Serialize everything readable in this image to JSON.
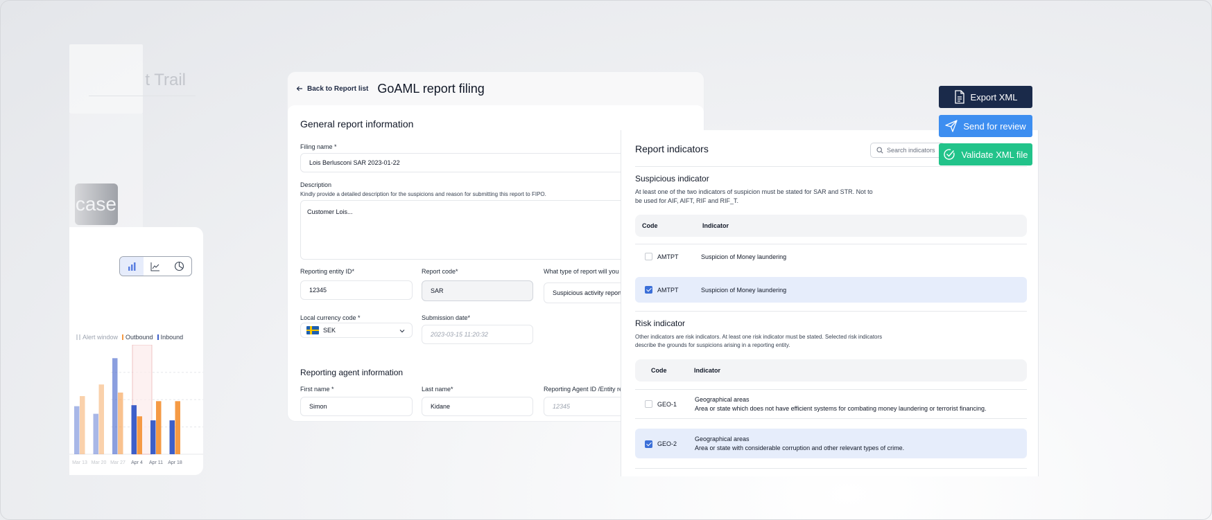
{
  "background": {
    "faded_title": "t Trail",
    "faded_button": "case"
  },
  "chart_card": {
    "legend": [
      "Alert window",
      "Outbound",
      "Inbound"
    ],
    "view_icons": [
      "bar-chart-icon",
      "line-chart-icon",
      "pie-chart-icon"
    ]
  },
  "chart_data": {
    "type": "bar",
    "categories": [
      "Mar 13",
      "Mar 20",
      "Mar 27",
      "Apr 4",
      "Apr 11",
      "Apr 18"
    ],
    "series": [
      {
        "name": "Inbound",
        "values": [
          9.5,
          8,
          19,
          9.7,
          6.7,
          6.7
        ]
      },
      {
        "name": "Outbound",
        "values": [
          11.5,
          13.8,
          12.2,
          7.5,
          10.5,
          10.5
        ]
      }
    ],
    "highlight": {
      "name": "Alert window",
      "category": "Apr 4"
    },
    "colors": {
      "Inbound": "#3d5fc9",
      "Outbound": "#f59a44",
      "Alert window": "#dc2626"
    },
    "ylim": [
      0,
      20
    ],
    "faded_categories": [
      "Mar 13",
      "Mar 20",
      "Mar 27"
    ]
  },
  "form": {
    "back_label": "Back to Report list",
    "title": "GoAML report filing",
    "general_section": "General report information",
    "filing_name_label": "Filing name *",
    "filing_name_value": "Lois Berlusconi SAR 2023-01-22",
    "description_label": "Description",
    "description_hint": "Kindly provide a detailed description for the suspicions and reason for submitting this report to FIPO.",
    "description_value": "Customer Lois...",
    "reporting_entity_label": "Reporting entity ID*",
    "reporting_entity_value": "12345",
    "report_code_label": "Report code*",
    "report_code_value": "SAR",
    "report_type_label": "What type of report will you",
    "report_type_value": "Suspicious activity report",
    "currency_label": "Local currency code *",
    "currency_value": "SEK",
    "submission_label": "Submission date*",
    "submission_placeholder": "2023-03-15 11:20:32",
    "agent_section": "Reporting agent information",
    "first_name_label": "First name *",
    "first_name_value": "Simon",
    "last_name_label": "Last name*",
    "last_name_value": "Kidane",
    "agent_id_label": "Reporting Agent ID /Entity re",
    "agent_id_placeholder": "12345"
  },
  "indicators": {
    "title": "Report indicators",
    "search_placeholder": "Search indicators",
    "suspicious_title": "Suspicious indicator",
    "suspicious_desc_1": "At least one of the two indicators of suspicion must be stated for SAR and STR. Not to",
    "suspicious_desc_2": "be used for AIF, AIFT, RIF and RIF_T.",
    "col_code": "Code",
    "col_indicator": "Indicator",
    "suspicious_rows": [
      {
        "code": "AMTPT",
        "indicator": "Suspicion of  Money laundering",
        "checked": false
      },
      {
        "code": "AMTPT",
        "indicator": "Suspicion of  Money laundering",
        "checked": true
      }
    ],
    "risk_title": "Risk indicator",
    "risk_desc_1": "Other indicators are risk indicators. At least one risk indicator must be stated. Selected risk indicators",
    "risk_desc_2": "describe the grounds for suspicions arising in a reporting entity.",
    "risk_rows": [
      {
        "code": "GEO-1",
        "indicator": "Geographical areas",
        "detail": "Area or state which does not have efficient systems for combating money laundering or terrorist financing.",
        "checked": false
      },
      {
        "code": "GEO-2",
        "indicator": "Geographical areas",
        "detail": "Area or state with considerable corruption and other relevant types of crime.",
        "checked": true
      }
    ]
  },
  "actions": {
    "export": "Export XML",
    "review": "Send for review",
    "validate": "Validate XML file"
  }
}
